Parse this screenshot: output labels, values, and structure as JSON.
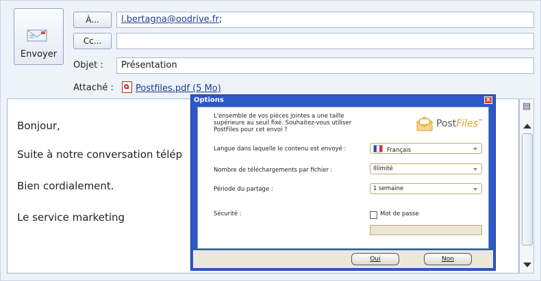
{
  "compose": {
    "send_label": "Envoyer",
    "to_button": "À...",
    "cc_button": "Cc...",
    "to_value": "l.bertagna@oodrive.fr",
    "to_separator": ";",
    "cc_value": "",
    "subject_label": "Objet :",
    "subject_value": "Présentation",
    "attached_label": "Attaché :",
    "attachment_name": "Postfiles.pdf (5 Mo)"
  },
  "body": {
    "lines": [
      "Bonjour,",
      "Suite à notre conversation télép",
      "Bien cordialement.",
      "Le service marketing"
    ]
  },
  "dialog": {
    "title": "Options",
    "close_glyph": "x",
    "intro": "L'ensemble de vos pièces jointes a une taille supérieure au seuil fixé. Souhaitez-vous utiliser PostFiles pour cet envoi ?",
    "logo_main": "Post",
    "logo_accent": "Files",
    "logo_mark": "™",
    "options": [
      {
        "label": "Langue dans laquelle le contenu est envoyé :",
        "value": "Français"
      },
      {
        "label": "Nombre de téléchargements par fichier :",
        "value": "Illimité"
      },
      {
        "label": "Période du partage :",
        "value": "1 semaine"
      }
    ],
    "security_label": "Sécurité :",
    "password_checkbox_label": "Mot de passe",
    "password_checked": false,
    "yes_button": "Oui",
    "no_button": "Non"
  },
  "colors": {
    "dialog_title_bar": "#2e57c9",
    "logo_accent": "#f09a1a",
    "link": "#1a3c8c"
  }
}
